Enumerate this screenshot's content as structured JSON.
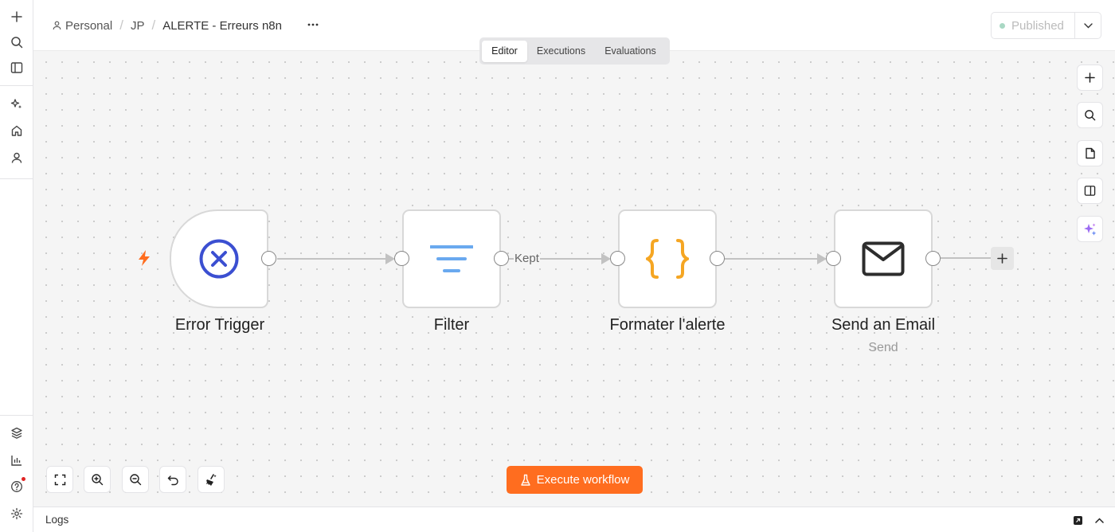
{
  "breadcrumb": {
    "owner": "Personal",
    "folder": "JP",
    "workflow": "ALERTE - Erreurs n8n"
  },
  "publish": {
    "label": "Published"
  },
  "tabs": [
    {
      "label": "Editor"
    },
    {
      "label": "Executions"
    },
    {
      "label": "Evaluations"
    }
  ],
  "nodes": [
    {
      "name": "Error Trigger",
      "subtitle": ""
    },
    {
      "name": "Filter",
      "subtitle": ""
    },
    {
      "name": "Formater l'alerte",
      "subtitle": ""
    },
    {
      "name": "Send an Email",
      "subtitle": "Send"
    }
  ],
  "edge_labels": {
    "filter_output": "Kept"
  },
  "execute": {
    "label": "Execute workflow"
  },
  "logs": {
    "label": "Logs"
  },
  "colors": {
    "accent": "#ff6d1f",
    "trigger_icon": "#3b4fd1",
    "filter_icon": "#6aa9ef",
    "code_icon": "#f5a623",
    "published_dot": "#a9d8c4"
  }
}
